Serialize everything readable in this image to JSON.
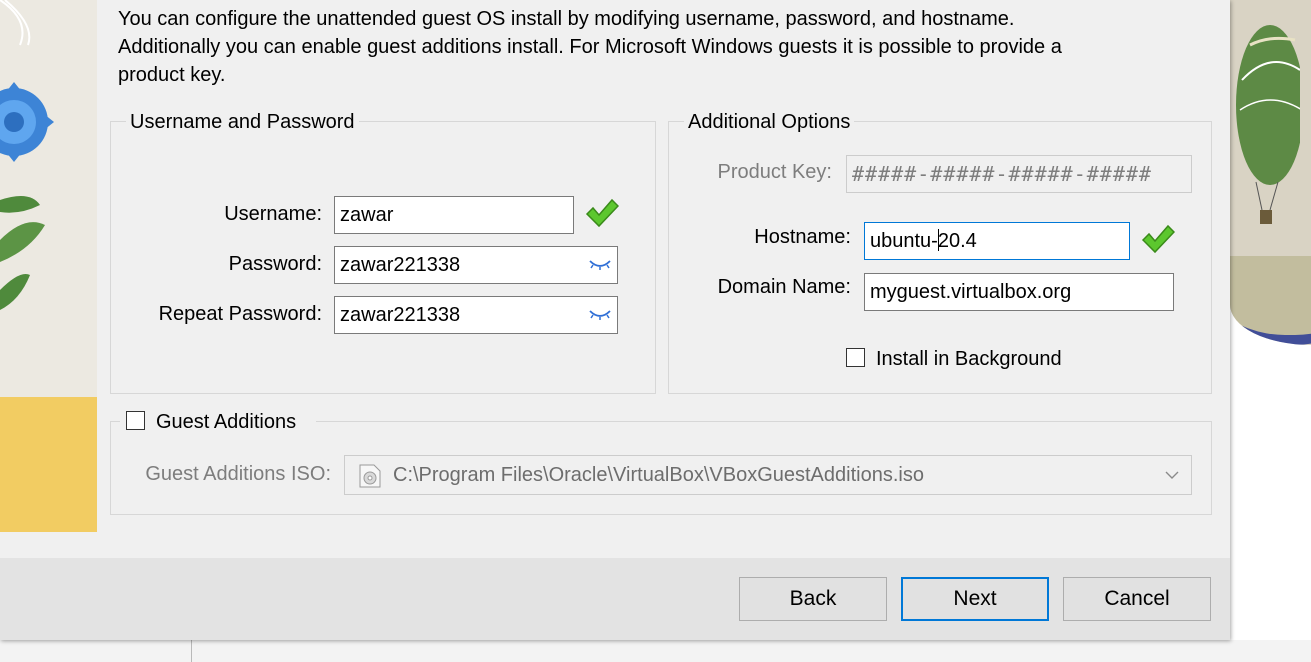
{
  "description": "You can configure the unattended guest OS install by modifying username, password, and hostname. Additionally you can enable guest additions install. For Microsoft Windows guests it is possible to provide a product key.",
  "username_group": {
    "title": "Username and Password",
    "username_label": "Username:",
    "username_value": "zawar",
    "password_label": "Password:",
    "password_value": "zawar221338",
    "repeat_label": "Repeat Password:",
    "repeat_value": "zawar221338"
  },
  "options_group": {
    "title": "Additional Options",
    "product_key_label": "Product Key:",
    "product_key_value": "#####-#####-#####-#####",
    "hostname_label": "Hostname:",
    "hostname_before_caret": "ubuntu-",
    "hostname_after_caret": "20.4",
    "domain_label": "Domain Name:",
    "domain_value": "myguest.virtualbox.org",
    "install_background_label": "Install in Background",
    "install_background_checked": false
  },
  "guest_additions": {
    "label": "Guest Additions",
    "checked": false,
    "iso_label": "Guest Additions ISO:",
    "iso_path": "C:\\Program Files\\Oracle\\VirtualBox\\VBoxGuestAdditions.iso"
  },
  "buttons": {
    "back": "Back",
    "next": "Next",
    "cancel": "Cancel"
  },
  "colors": {
    "accent": "#0078d7",
    "valid_check": "#5cc72e",
    "dialog_bg": "#f0f0f0"
  }
}
